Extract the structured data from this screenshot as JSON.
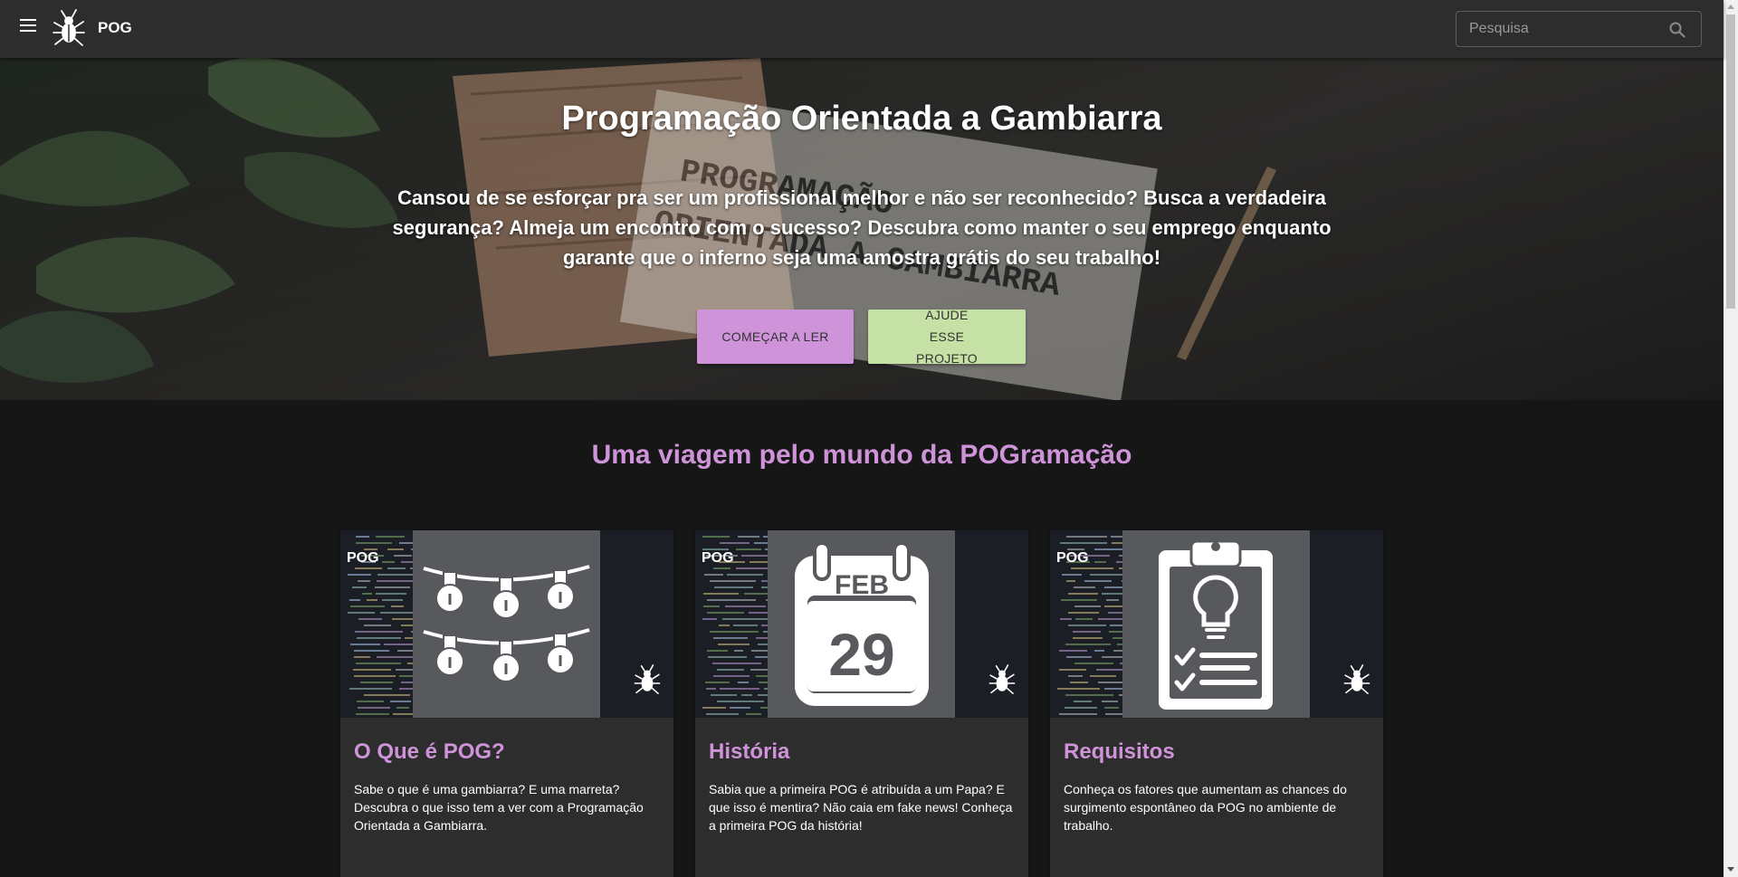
{
  "header": {
    "brand": "POG",
    "search_placeholder": "Pesquisa"
  },
  "hero": {
    "title": "Programação Orientada a Gambiarra",
    "text": "Cansou de se esforçar pra ser um profissional melhor e não ser reconhecido? Busca a verdadeira segurança? Almeja um encontro com o sucesso? Descubra como manter o seu emprego enquanto garante que o inferno seja uma amostra grátis do seu trabalho!",
    "primary_button": "COMEÇAR A LER",
    "secondary_button": "AJUDE ESSE PROJETO"
  },
  "section": {
    "title": "Uma viagem pelo mundo da POGramação"
  },
  "cards": [
    {
      "tag": "POG",
      "icon": "string-lights-icon",
      "title": "O Que é POG?",
      "text": "Sabe o que é uma gambiarra? E uma marreta? Descubra o que isso tem a ver com a Programação Orientada a Gambiarra."
    },
    {
      "tag": "POG",
      "icon": "calendar-icon",
      "calendar_month": "FEB",
      "calendar_day": "29",
      "title": "História",
      "text": "Sabia que a primeira POG é atribuída a um Papa? E que isso é mentira? Não caia em fake news! Conheça a primeira POG da história!"
    },
    {
      "tag": "POG",
      "icon": "clipboard-checklist-icon",
      "title": "Requisitos",
      "text": "Conheça os fatores que aumentam as chances do surgimento espontâneo da POG no ambiente de trabalho."
    }
  ],
  "colors": {
    "accent_purple": "#ce93d8",
    "accent_green": "#c5e1a5",
    "toolbar": "#2d2d2d",
    "page_bg": "#161616"
  }
}
